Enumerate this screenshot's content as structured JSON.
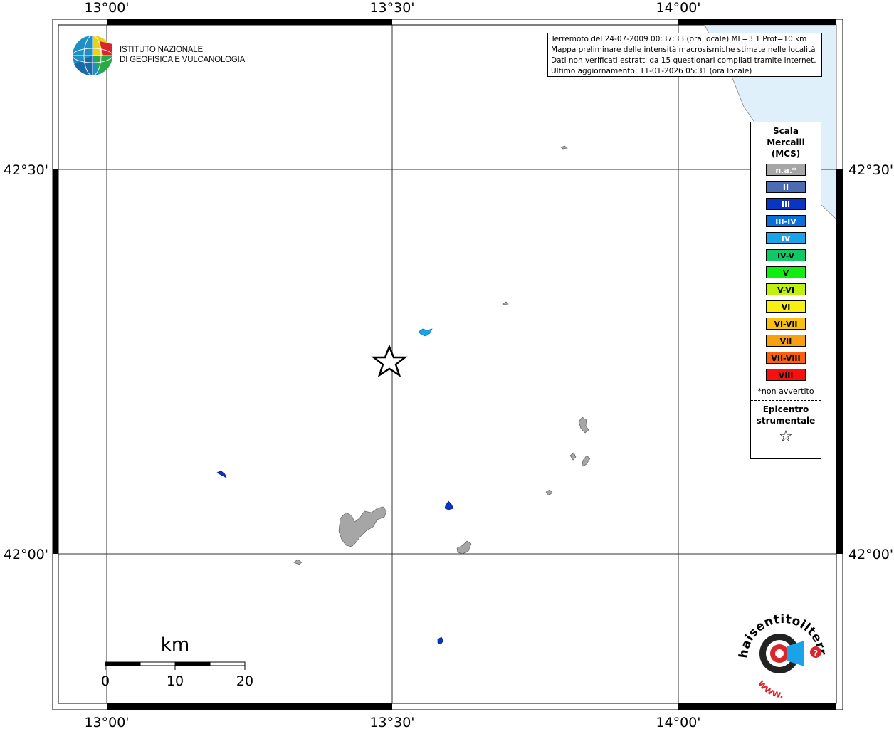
{
  "map": {
    "lon_labels": [
      "13°00'",
      "13°30'",
      "14°00'"
    ],
    "lat_labels": [
      "42°30'",
      "42°00'"
    ]
  },
  "header": {
    "institute_line1": "ISTITUTO NAZIONALE",
    "institute_line2": "DI GEOFISICA E VULCANOLOGIA"
  },
  "info": {
    "line1": "Terremoto del 24-07-2009 00:37:33 (ora locale) ML=3.1 Prof=10 km",
    "line2": "Mappa preliminare delle intensità macrosismiche stimate nelle località",
    "line3": "Dati non verificati estratti da 15 questionari compilati tramite Internet.",
    "line4": "Ultimo aggiornamento: 11-01-2026 05:31 (ora locale)"
  },
  "legend": {
    "title1": "Scala",
    "title2": "Mercalli",
    "title3": "(MCS)",
    "items": [
      {
        "label": "n.a.*",
        "color": "#a6a6a6",
        "text_color": "#ffffff"
      },
      {
        "label": "II",
        "color": "#4d6bb3",
        "text_color": "#ffffff"
      },
      {
        "label": "III",
        "color": "#0a34c2",
        "text_color": "#ffffff"
      },
      {
        "label": "III-IV",
        "color": "#0a6fd8",
        "text_color": "#ffffff"
      },
      {
        "label": "IV",
        "color": "#1aa3e8",
        "text_color": "#ffffff"
      },
      {
        "label": "IV-V",
        "color": "#10c864",
        "text_color": "#000000"
      },
      {
        "label": "V",
        "color": "#10ee10",
        "text_color": "#000000"
      },
      {
        "label": "V-VI",
        "color": "#c0f010",
        "text_color": "#000000"
      },
      {
        "label": "VI",
        "color": "#f8f010",
        "text_color": "#000000"
      },
      {
        "label": "VI-VII",
        "color": "#f8c010",
        "text_color": "#000000"
      },
      {
        "label": "VII",
        "color": "#f8a010",
        "text_color": "#000000"
      },
      {
        "label": "VII-VIII",
        "color": "#f86010",
        "text_color": "#000000"
      },
      {
        "label": "VIII",
        "color": "#f81010",
        "text_color": "#000000"
      }
    ],
    "note": "*non avvertito",
    "epicentre1": "Epicentro",
    "epicentre2": "strumentale"
  },
  "scale_bar": {
    "unit": "km",
    "ticks": [
      "0",
      "10",
      "20"
    ]
  },
  "footer_logo": {
    "text": "haisentitoilterremoto.it",
    "www": "www."
  },
  "colors": {
    "sea": "#dff0fb",
    "na_gray": "#a6a6a6",
    "intensity_III": "#0a34c2",
    "intensity_IV": "#1aa3e8"
  }
}
